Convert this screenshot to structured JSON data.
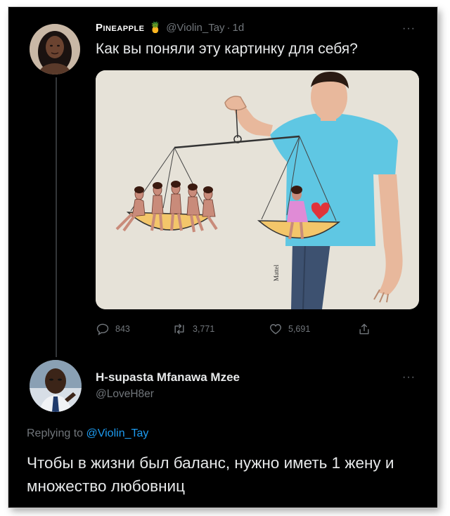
{
  "tweet": {
    "author_name": "Pineapple",
    "emoji": "🍍",
    "handle": "@Violin_Tay",
    "separator": "·",
    "time": "1d",
    "more": "···",
    "text": "Как вы поняли эту картинку для себя?",
    "media_signature": "Mattel",
    "stats": {
      "replies": "843",
      "retweets": "3,771",
      "likes": "5,691"
    }
  },
  "reply": {
    "author_name": "H-supasta Mfanawa Mzee",
    "handle": "@LoveH8er",
    "more": "···",
    "replying_prefix": "Replying to",
    "replying_handle": "@Violin_Tay",
    "text": "Чтобы в жизни был баланс, нужно иметь 1 жену и множество любовниц"
  },
  "colors": {
    "background": "#000000",
    "text": "#e7e9ea",
    "muted": "#71767b",
    "link": "#1d9bf0",
    "media_bg": "#e6e2d8",
    "shirt": "#5fc7e3",
    "pants": "#3d5170",
    "pan": "#f3c66a"
  },
  "icons": [
    "reply-icon",
    "retweet-icon",
    "like-icon",
    "share-icon",
    "more-icon",
    "pineapple-emoji"
  ]
}
